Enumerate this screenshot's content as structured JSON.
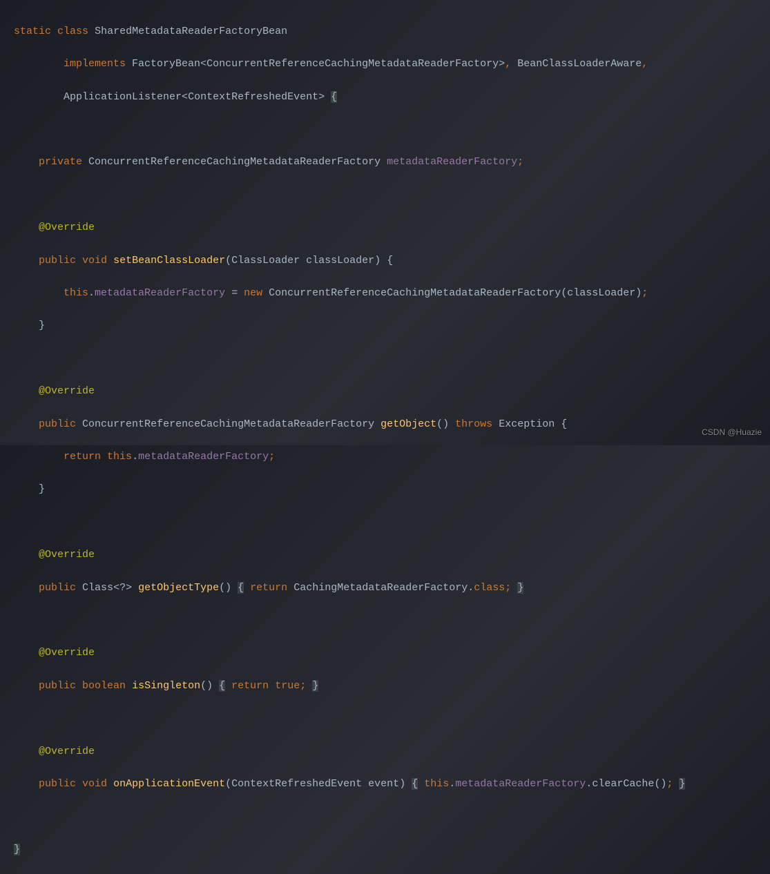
{
  "watermark": "CSDN @Huazie",
  "code": {
    "l1_static": "static",
    "l1_class": "class",
    "l1_name": "SharedMetadataReaderFactoryBean",
    "l2_impl": "implements",
    "l2_fb": "FactoryBean",
    "l2_gen": "ConcurrentReferenceCachingMetadataReaderFactory",
    "l2_bcl": "BeanClassLoaderAware",
    "l3_al": "ApplicationListener",
    "l3_cre": "ContextRefreshedEvent",
    "l5_private": "private",
    "l5_type": "ConcurrentReferenceCachingMetadataReaderFactory",
    "l5_field": "metadataReaderFactory",
    "override": "@Override",
    "public": "public",
    "void": "void",
    "setbcl": "setBeanClassLoader",
    "cl_type": "ClassLoader",
    "cl_param": "classLoader",
    "this": "this",
    "mrf": "metadataReaderFactory",
    "new": "new",
    "crcmrf": "ConcurrentReferenceCachingMetadataReaderFactory",
    "getobj": "getObject",
    "throws": "throws",
    "exception": "Exception",
    "return": "return",
    "class_kw": "Class",
    "wildcard": "<?>",
    "gettype": "getObjectType",
    "cmrf": "CachingMetadataReaderFactory",
    "dotclass": "class",
    "boolean": "boolean",
    "issingleton": "isSingleton",
    "true": "true",
    "onappevent": "onApplicationEvent",
    "cre": "ContextRefreshedEvent",
    "event": "event",
    "clearcache": "clearCache"
  }
}
